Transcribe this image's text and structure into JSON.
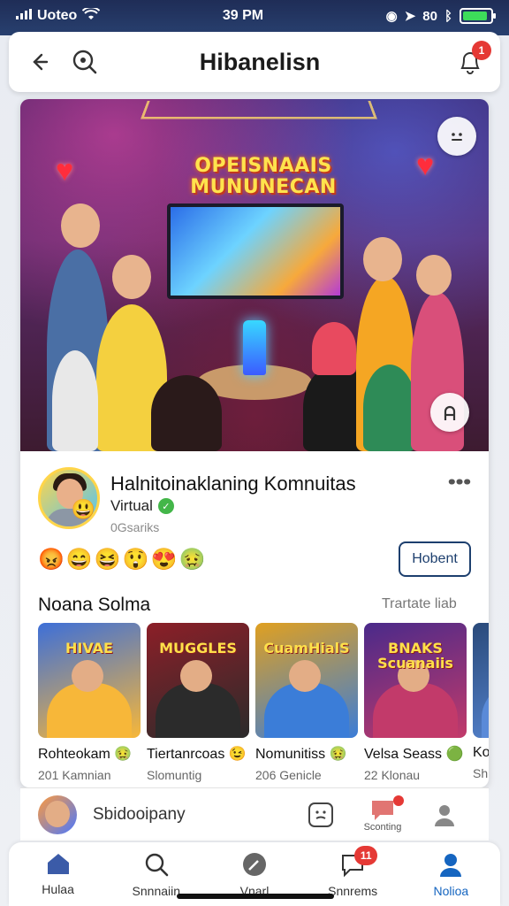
{
  "status_bar": {
    "carrier": "Uoteo",
    "time": "39 PM",
    "battery_label": "80",
    "battery_level": 0.9
  },
  "header": {
    "title": "Hibanelisn",
    "notification_count": "1"
  },
  "hero": {
    "sign_text": "OPEISNAAIS MUNUNECAN"
  },
  "community": {
    "name": "Halnitoinaklaning Komnuitas",
    "status": "Virtual",
    "members": "0Gsariks",
    "reactions": [
      "😡",
      "😄",
      "😆",
      "😲",
      "😍",
      "🤢"
    ],
    "join_label": "Hobent"
  },
  "section": {
    "title": "Noana Solma",
    "link": "Trartate liab",
    "tiles": [
      {
        "tag": "HIVAE",
        "name": "Rohteokam",
        "emoji": "🤢",
        "sub": "201 Kamnian",
        "bg": "#3d6fd8",
        "accent": "#f7b739"
      },
      {
        "tag": "MUGGLES",
        "name": "Tiertanrcoas",
        "emoji": "😉",
        "sub": "Slomuntig",
        "bg": "#8c1f28",
        "accent": "#2b2b2b"
      },
      {
        "tag": "CuamHialS",
        "name": "Nomunitiss",
        "emoji": "🤢",
        "sub": "206 Genicle",
        "bg": "#e0a020",
        "accent": "#3b7dd8"
      },
      {
        "tag": "BNAKS Scuanaiis",
        "name": "Velsa Seass",
        "emoji": "🟢",
        "sub": "22 Klonau",
        "bg": "#4a2a8a",
        "accent": "#c23a6a"
      },
      {
        "tag": "",
        "name": "Ko",
        "emoji": "",
        "sub": "Sh",
        "bg": "#2a4a7a",
        "accent": "#5a8ad8"
      }
    ]
  },
  "friends_row": {
    "label": "Sbidooipany",
    "chat_label": "Sconting"
  },
  "tabbar": {
    "items": [
      {
        "label": "Hulaa",
        "icon": "home-icon"
      },
      {
        "label": "Snnnaiin",
        "icon": "search-icon"
      },
      {
        "label": "Vnarl",
        "icon": "compass-icon"
      },
      {
        "label": "Snnrems",
        "icon": "chat-icon",
        "badge": "11"
      },
      {
        "label": "Nolioa",
        "icon": "profile-icon"
      }
    ]
  },
  "colors": {
    "accent": "#1565c0",
    "badge": "#e53935",
    "online": "#43b649"
  }
}
